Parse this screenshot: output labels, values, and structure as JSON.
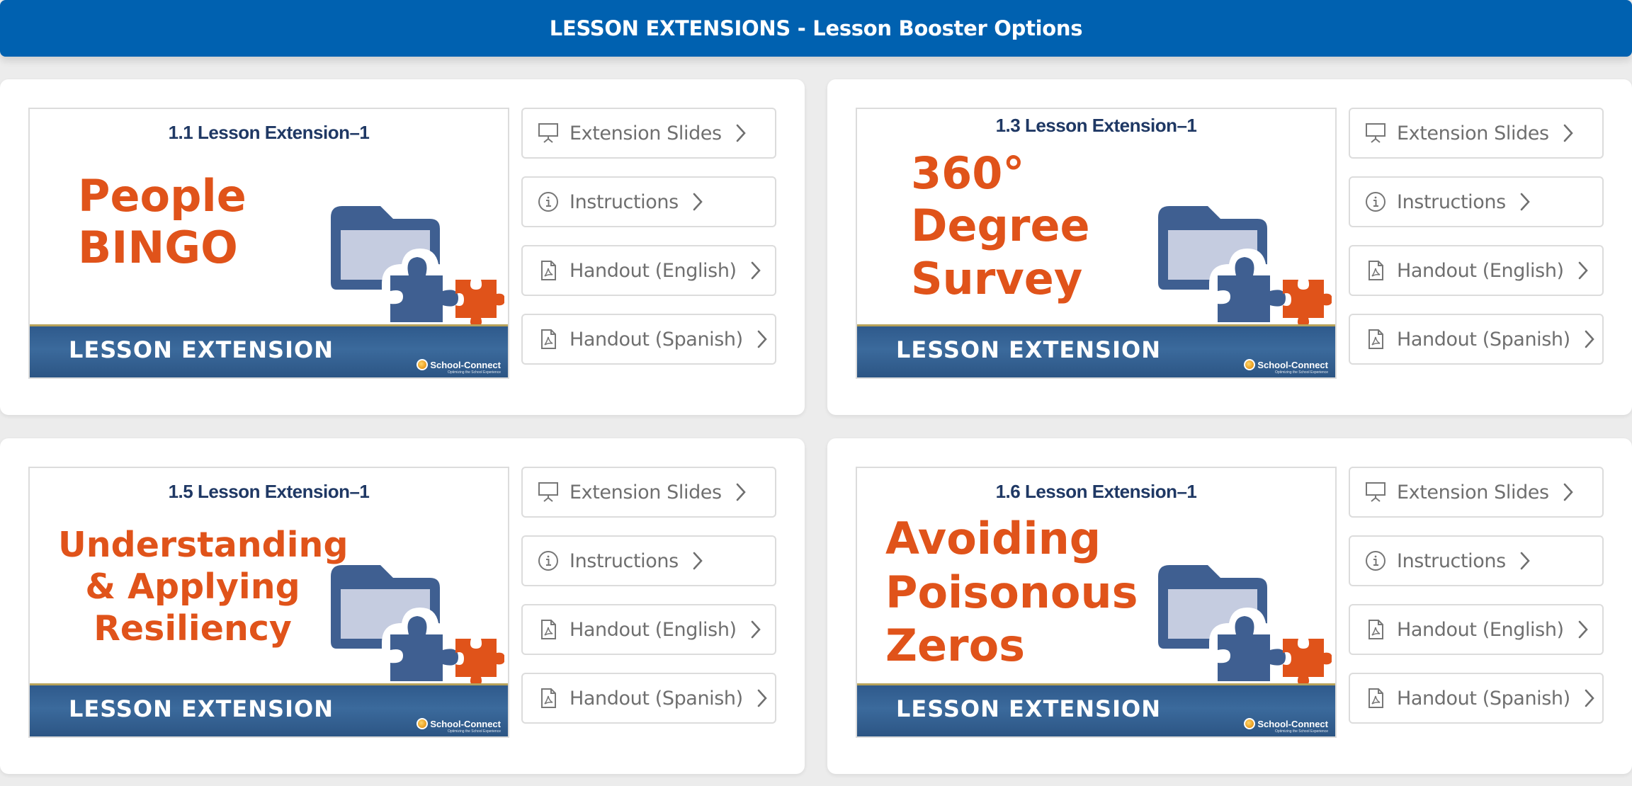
{
  "header": {
    "title": "LESSON EXTENSIONS - Lesson Booster Options"
  },
  "colors": {
    "header_bg": "#0061b0",
    "title_orange": "#e0531a",
    "heading_navy": "#1f3864",
    "icon_blue": "#3f5f91",
    "folder_fill": "#c5cce0"
  },
  "cards": [
    {
      "heading": "1.1 Lesson Extension–1",
      "title": "People\nBINGO",
      "banner": "LESSON EXTENSION",
      "logo": "School-Connect",
      "logo_tagline": "Optimizing the School Experience",
      "buttons": [
        {
          "icon": "presentation-icon",
          "label": "Extension Slides"
        },
        {
          "icon": "info-icon",
          "label": "Instructions"
        },
        {
          "icon": "pdf-file-icon",
          "label": "Handout (English)"
        },
        {
          "icon": "pdf-file-icon",
          "label": "Handout (Spanish)"
        }
      ]
    },
    {
      "heading": "1.3 Lesson Extension–1",
      "title": "360°\nDegree\nSurvey",
      "banner": "LESSON EXTENSION",
      "logo": "School-Connect",
      "logo_tagline": "Optimizing the School Experience",
      "buttons": [
        {
          "icon": "presentation-icon",
          "label": "Extension Slides"
        },
        {
          "icon": "info-icon",
          "label": "Instructions"
        },
        {
          "icon": "pdf-file-icon",
          "label": "Handout (English)"
        },
        {
          "icon": "pdf-file-icon",
          "label": "Handout (Spanish)"
        }
      ]
    },
    {
      "heading": "1.5 Lesson Extension–1",
      "title": "Understanding\n& Applying\nResiliency",
      "banner": "LESSON EXTENSION",
      "logo": "School-Connect",
      "logo_tagline": "Optimizing the School Experience",
      "buttons": [
        {
          "icon": "presentation-icon",
          "label": "Extension Slides"
        },
        {
          "icon": "info-icon",
          "label": "Instructions"
        },
        {
          "icon": "pdf-file-icon",
          "label": "Handout (English)"
        },
        {
          "icon": "pdf-file-icon",
          "label": "Handout (Spanish)"
        }
      ]
    },
    {
      "heading": "1.6 Lesson Extension–1",
      "title": "Avoiding\nPoisonous\nZeros",
      "banner": "LESSON EXTENSION",
      "logo": "School-Connect",
      "logo_tagline": "Optimizing the School Experience",
      "buttons": [
        {
          "icon": "presentation-icon",
          "label": "Extension Slides"
        },
        {
          "icon": "info-icon",
          "label": "Instructions"
        },
        {
          "icon": "pdf-file-icon",
          "label": "Handout (English)"
        },
        {
          "icon": "pdf-file-icon",
          "label": "Handout (Spanish)"
        }
      ]
    }
  ]
}
